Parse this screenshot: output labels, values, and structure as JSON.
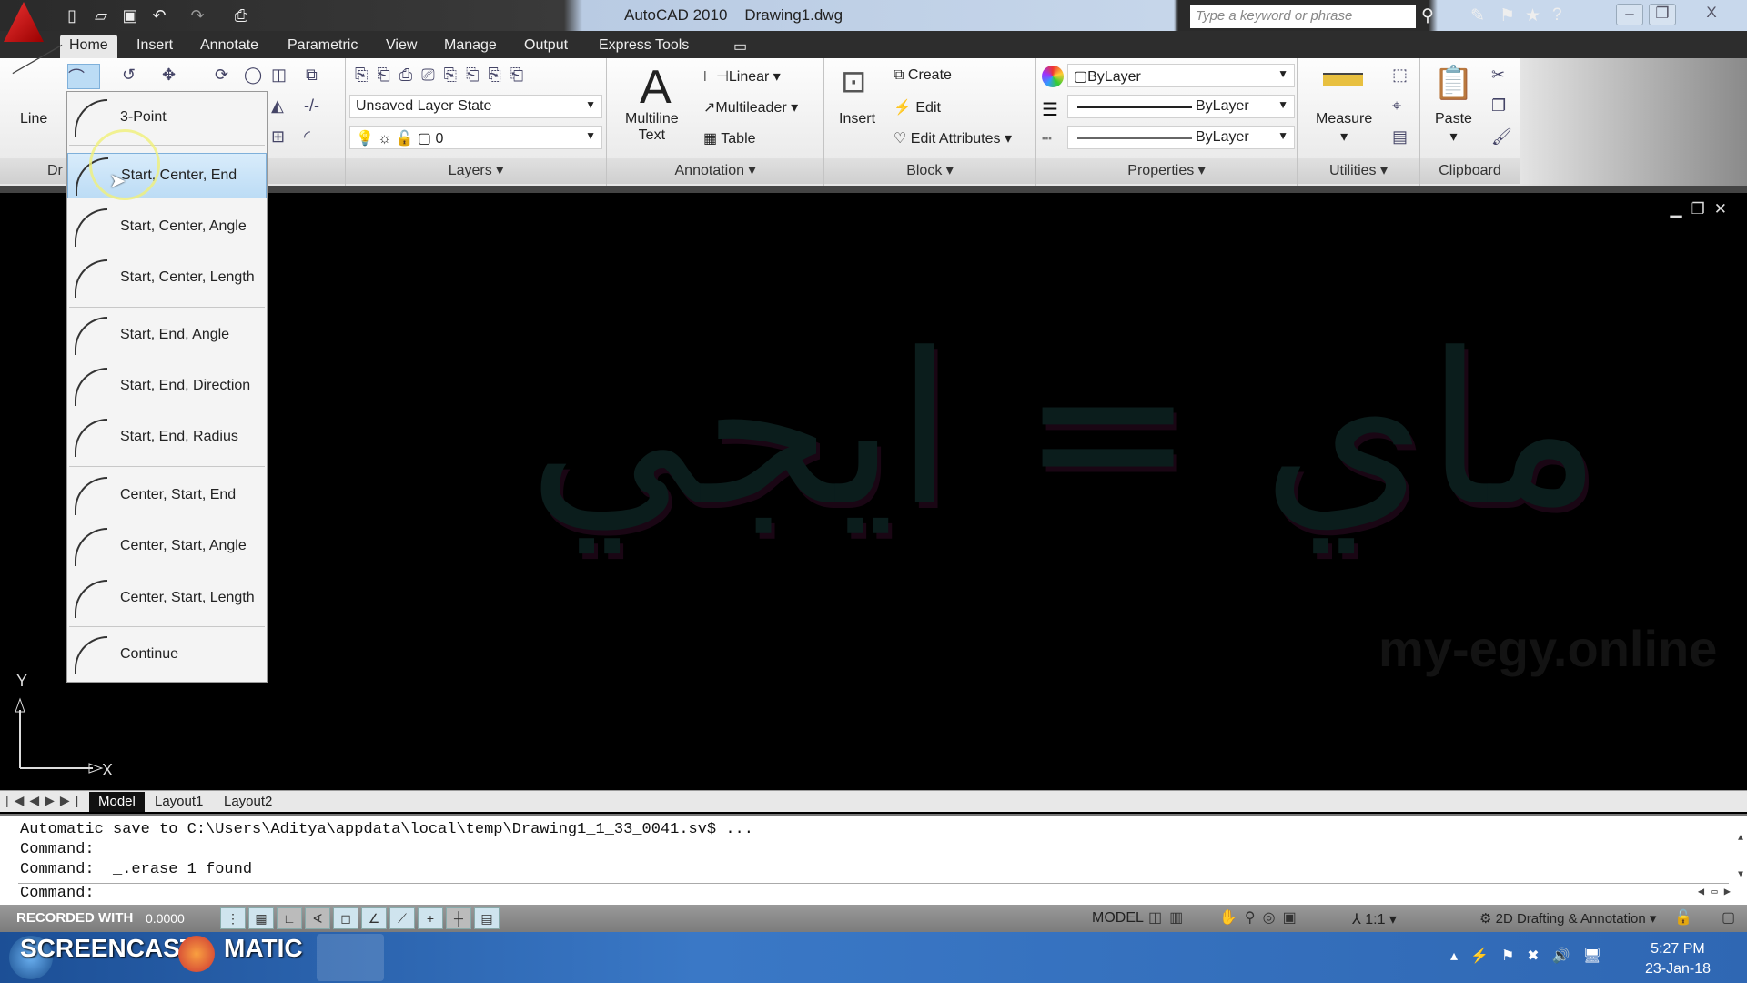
{
  "titlebar": {
    "app": "AutoCAD 2010",
    "file": "Drawing1.dwg",
    "search_placeholder": "Type a keyword or phrase",
    "quick_access": [
      "new-icon",
      "open-icon",
      "save-icon",
      "undo-icon",
      "redo-icon",
      "plot-icon"
    ]
  },
  "tabs": [
    "Home",
    "Insert",
    "Annotate",
    "Parametric",
    "View",
    "Manage",
    "Output",
    "Express Tools"
  ],
  "ribbon": {
    "draw": {
      "line": "Line",
      "label": "Dr"
    },
    "layers": {
      "state": "Unsaved Layer State",
      "layer": "0",
      "label": "Layers"
    },
    "annotation": {
      "text_line1": "Multiline",
      "text_line2": "Text",
      "linear": "Linear",
      "multileader": "Multileader",
      "table": "Table",
      "label": "Annotation"
    },
    "block": {
      "insert": "Insert",
      "create": "Create",
      "edit": "Edit",
      "edit_attributes": "Edit Attributes",
      "label": "Block"
    },
    "properties": {
      "color": "ByLayer",
      "linetype": "ByLayer",
      "lineweight": "ByLayer",
      "label": "Properties"
    },
    "utilities": {
      "measure": "Measure",
      "label": "Utilities"
    },
    "clipboard": {
      "paste": "Paste",
      "label": "Clipboard"
    }
  },
  "arc_menu": {
    "items": [
      "3-Point",
      "Start, Center, End",
      "Start, Center, Angle",
      "Start, Center, Length",
      "Start, End, Angle",
      "Start, End, Direction",
      "Start, End, Radius",
      "Center, Start, End",
      "Center, Start, Angle",
      "Center, Start, Length",
      "Continue"
    ],
    "highlighted": "Start, Center, End"
  },
  "watermark": {
    "arabic": "ماي = ايجي",
    "url": "my-egy.online"
  },
  "ucs": {
    "x": "X",
    "y": "Y"
  },
  "layout_tabs": [
    "Model",
    "Layout1",
    "Layout2"
  ],
  "command": {
    "lines": [
      "Automatic save to C:\\Users\\Aditya\\appdata\\local\\temp\\Drawing1_1_33_0041.sv$ ...",
      "Command:",
      "Command:  _.erase 1 found"
    ],
    "prompt": "Command:"
  },
  "status": {
    "coords": "0.0000",
    "recorded": "RECORDED WITH",
    "model": "MODEL",
    "scale": "1:1",
    "workspace": "2D Drafting & Annotation"
  },
  "taskbar": {
    "brand": "SCREENCAST",
    "brand2": "MATIC",
    "time": "5:27 PM",
    "date": "23-Jan-18"
  }
}
